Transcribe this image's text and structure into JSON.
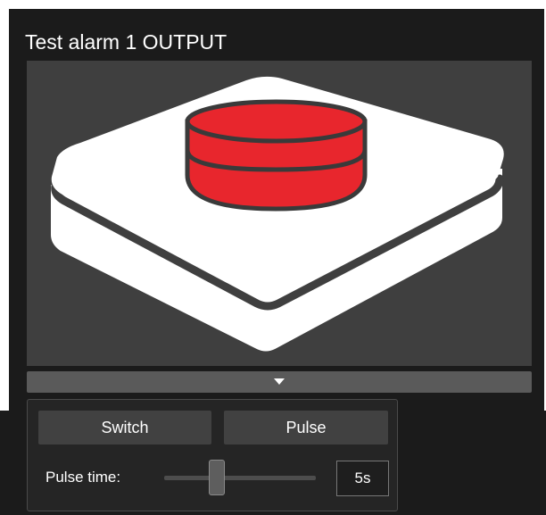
{
  "panel": {
    "title": "Test alarm 1 OUTPUT",
    "image_icon": "red-push-button-illustration",
    "expand_icon": "triangle-down-icon"
  },
  "controls": {
    "switch_label": "Switch",
    "pulse_label": "Pulse",
    "pulse_time_label": "Pulse time:",
    "pulse_time_value": "5s",
    "pulse_time_slider_fraction": 0.35
  },
  "colors": {
    "button_red": "#e8262d",
    "outline": "#3a3a3a",
    "panel_bg": "#1b1b1b",
    "image_bg": "#3f3f3f"
  }
}
